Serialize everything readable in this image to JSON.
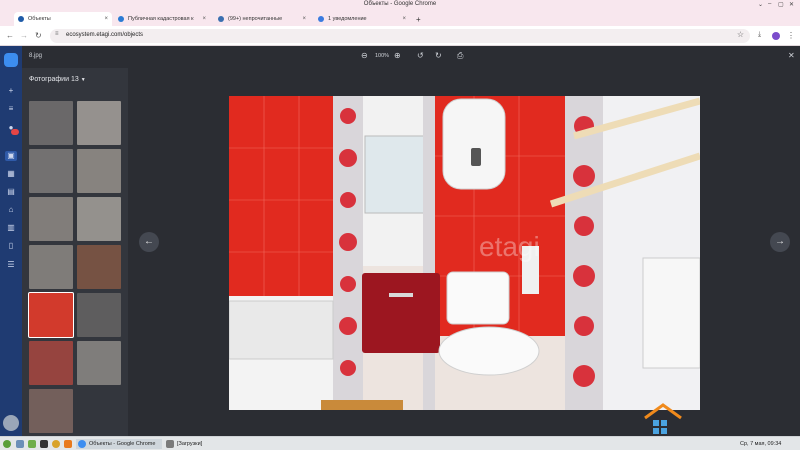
{
  "window": {
    "title": "Объекты - Google Chrome",
    "controls": [
      "⌄",
      "–",
      "▢",
      "✕"
    ]
  },
  "tabs": [
    {
      "label": "Объекты",
      "active": true,
      "favicon_color": "#1f5ba8"
    },
    {
      "label": "Публичная кадастровая к",
      "active": false,
      "favicon_color": "#2a7bd4"
    },
    {
      "label": "(99+) непрочитанные",
      "active": false,
      "favicon_color": "#3a6fb0"
    },
    {
      "label": "1 уведомление",
      "active": false,
      "favicon_color": "#3a7be0"
    }
  ],
  "new_tab_label": "+",
  "address": {
    "url": "ecosystem.etagi.com/objects"
  },
  "viewer": {
    "filename": "8.jpg",
    "zoom": "100%",
    "gallery_header": "Фотографии 13",
    "selected_index": 8,
    "thumb_colors": [
      "#7d7a78",
      "#b7b0aa",
      "#8a8683",
      "#a49d95",
      "#9c968f",
      "#b6b0a8",
      "#9a948d",
      "#8e5c45",
      "#d23a2c",
      "#6d6b69",
      "#b84940",
      "#9a9590",
      "#8a6e66"
    ],
    "watermark": "etagi"
  },
  "taskbar": {
    "items": [
      "Объекты - Google Chrome",
      "[Загрузки]"
    ],
    "clock": "Ср, 7 мая, 09:34"
  },
  "colors": {
    "sidebar": "#1f3b72",
    "panel": "#33363d",
    "viewer_bg": "#2b2d33",
    "selected": "#d8463c"
  }
}
